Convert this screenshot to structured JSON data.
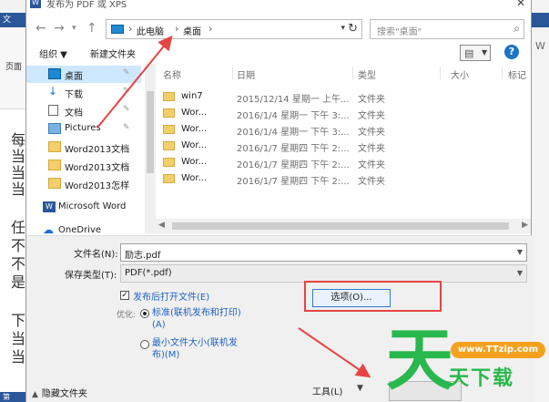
{
  "window": {
    "title": "发布为 PDF 或 XPS",
    "close_glyph": "✕"
  },
  "background_word": {
    "tab_label": "文",
    "view_label": "页面",
    "status_label": "第",
    "body_glyphs": [
      "每",
      "当",
      "当",
      "当",
      "任",
      "不",
      "不",
      "是",
      "下",
      "当",
      "当"
    ]
  },
  "address_bar": {
    "crumbs": [
      "此电脑",
      "桌面"
    ],
    "search_placeholder": "搜索\"桌面\""
  },
  "toolbar": {
    "organize_label": "组织 ▼",
    "new_folder_label": "新建文件夹"
  },
  "nav_pane": {
    "items": [
      {
        "label": "桌面",
        "icon": "desktop-icon",
        "pinned": true,
        "selected": true
      },
      {
        "label": "下载",
        "icon": "download-icon",
        "pinned": true
      },
      {
        "label": "文档",
        "icon": "document-icon",
        "pinned": true
      },
      {
        "label": "Pictures",
        "icon": "pictures-icon",
        "pinned": true
      },
      {
        "label": "Word2013文档",
        "icon": "folder-icon"
      },
      {
        "label": "Word2013文档",
        "icon": "folder-icon"
      },
      {
        "label": "Word2013怎样",
        "icon": "folder-icon"
      },
      {
        "label": "Microsoft Word",
        "icon": "word-icon"
      },
      {
        "label": "OneDrive",
        "icon": "onedrive-icon"
      }
    ]
  },
  "file_list": {
    "columns": [
      "名称",
      "日期",
      "类型",
      "大小",
      "标记"
    ],
    "rows": [
      {
        "name": "win7",
        "date": "2015/12/14 星期一 上午...",
        "type": "文件夹"
      },
      {
        "name": "Wor...",
        "date": "2016/1/4 星期一 下午 3:...",
        "type": "文件夹"
      },
      {
        "name": "Wor...",
        "date": "2016/1/4 星期一 下午 3:...",
        "type": "文件夹"
      },
      {
        "name": "Wor...",
        "date": "2016/1/7 星期四 下午 2:...",
        "type": "文件夹"
      },
      {
        "name": "Wor...",
        "date": "2016/1/7 星期四 下午 2:...",
        "type": "文件夹"
      },
      {
        "name": "Wor...",
        "date": "2016/1/7 星期四 下午 2:...",
        "type": "文件夹"
      }
    ]
  },
  "save_form": {
    "filename_label": "文件名(N):",
    "filename_value": "励志.pdf",
    "filetype_label": "保存类型(T):",
    "filetype_value": "PDF(*.pdf)",
    "open_after_label": "发布后打开文件(E)",
    "open_after_checked": true,
    "optimize_label": "优化:",
    "radio_standard_line1": "标准(联机发布和打印)",
    "radio_standard_line2": "(A)",
    "radio_min_line1": "最小文件大小(联机发",
    "radio_min_line2": "布)(M)",
    "options_button": "选项(O)..."
  },
  "footer": {
    "hide_folders_label": "隐藏文件夹",
    "tools_label": "工具(L)"
  },
  "watermark": {
    "big_char": "天",
    "url": "www.TTzip.com",
    "sub_text": "天下载"
  },
  "colors": {
    "annotation_red": "#e74444",
    "selection_blue": "#cde8ff",
    "link_blue": "#1d62c4",
    "watermark_green": "#29b84d",
    "watermark_orange": "#f5a11e"
  }
}
